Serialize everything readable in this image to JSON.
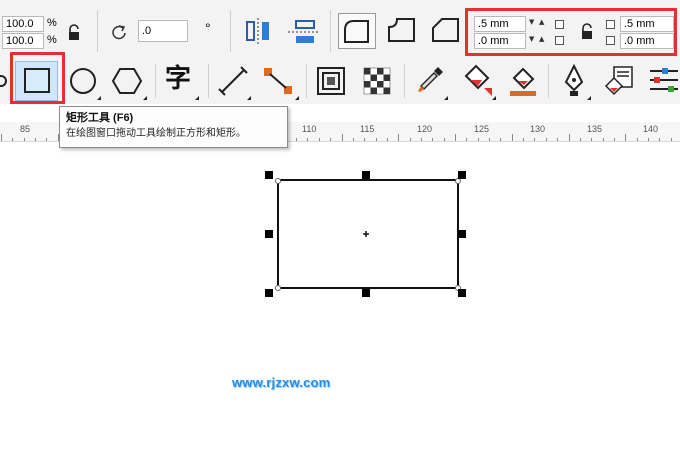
{
  "property_bar": {
    "scale_x": "100.0",
    "scale_y": "100.0",
    "percent_symbol": "%",
    "rotation_value": ".0",
    "rotation_unit": "°",
    "corner_radius_top_left": ".5 mm",
    "corner_radius_bottom_left": ".0 mm",
    "corner_radius_top_right": ".5 mm",
    "corner_radius_bottom_right": ".0 mm"
  },
  "toolbar": {
    "text_tool_glyph": "字"
  },
  "tooltip": {
    "title": "矩形工具 (F6)",
    "description": "在绘图窗口拖动工具绘制正方形和矩形。"
  },
  "ruler": {
    "labels": [
      "85",
      "110",
      "115",
      "120",
      "125",
      "130",
      "135",
      "140"
    ]
  },
  "watermark": "www.rjzxw.com",
  "colors": {
    "highlight": "#e53030",
    "selected_tool_bg": "#cfe6fb",
    "accent_orange": "#e06a1b",
    "accent_blue": "#2a7fd4"
  }
}
